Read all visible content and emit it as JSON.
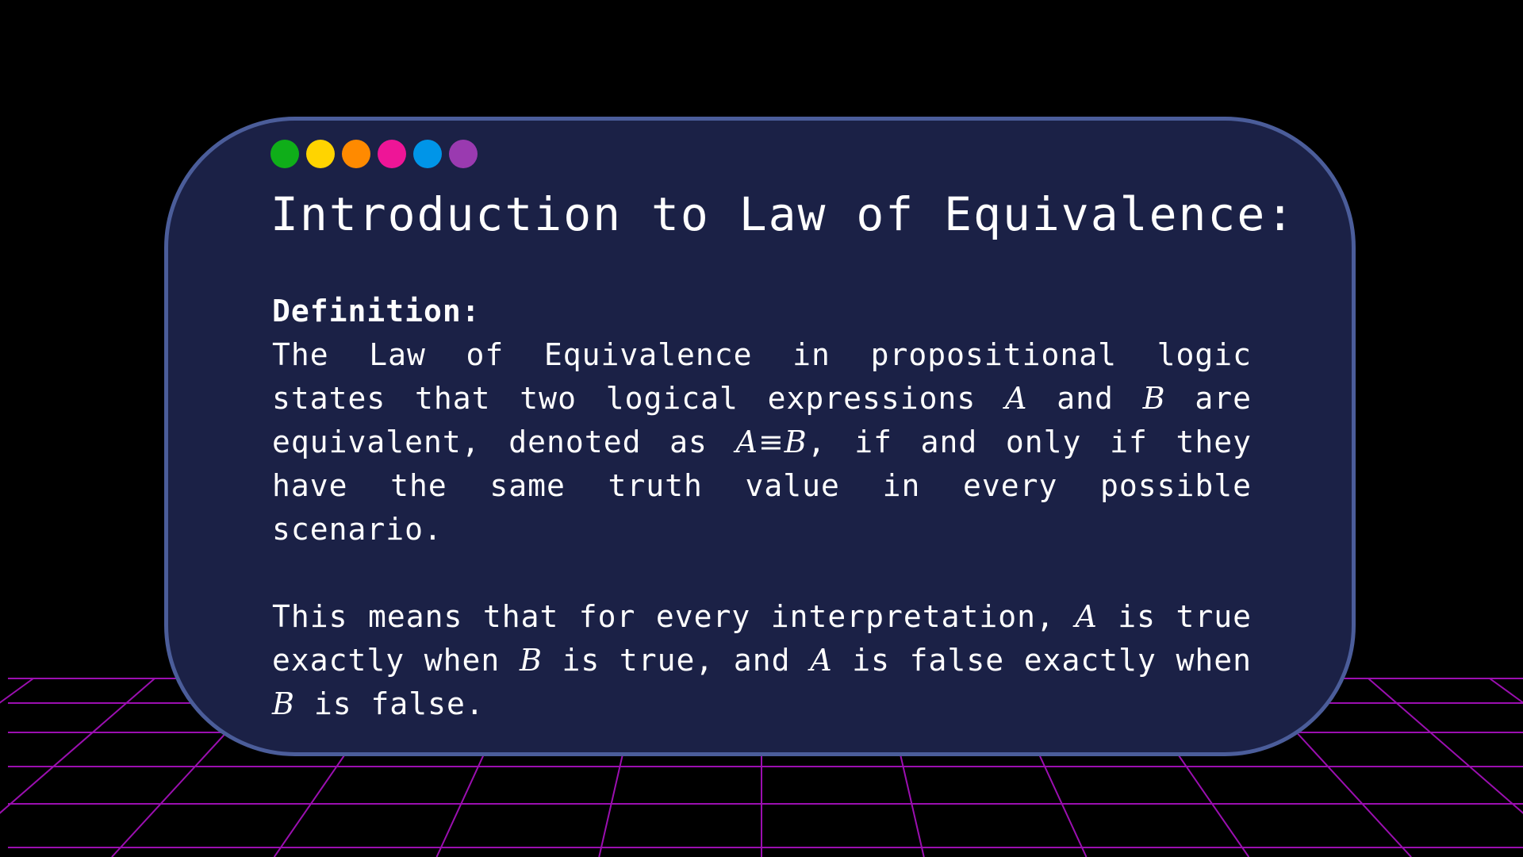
{
  "window_controls": [
    {
      "name": "green",
      "color": "#0fae19"
    },
    {
      "name": "yellow",
      "color": "#ffd400"
    },
    {
      "name": "orange",
      "color": "#ff8a00"
    },
    {
      "name": "pink",
      "color": "#ee1597"
    },
    {
      "name": "blue",
      "color": "#0095e8"
    },
    {
      "name": "purple",
      "color": "#9a3ab0"
    }
  ],
  "title": "Introduction to Law of Equivalence:",
  "definition": {
    "label": "Definition:",
    "p1": {
      "t1": "The Law of Equivalence in propositional logic states that two logical expressions ",
      "v1": "A",
      "t2": " and ",
      "v2": "B",
      "t3": " are equivalent, denoted as ",
      "v3": "A≡B",
      "t4": ", if and only if they have the same truth value in every possible scenario."
    },
    "p2": {
      "t1": "This means that for every interpretation, ",
      "v1": "A",
      "t2": " is true exactly when ",
      "v2": "B",
      "t3": " is true, and ",
      "v3": "A",
      "t4": " is false exactly when ",
      "v4": "B",
      "t5": " is false."
    }
  },
  "colors": {
    "background": "#000000",
    "card_fill": "#1b2146",
    "card_border": "#4b5d9a",
    "grid_line": "#9b0fb0",
    "text": "#ffffff"
  }
}
